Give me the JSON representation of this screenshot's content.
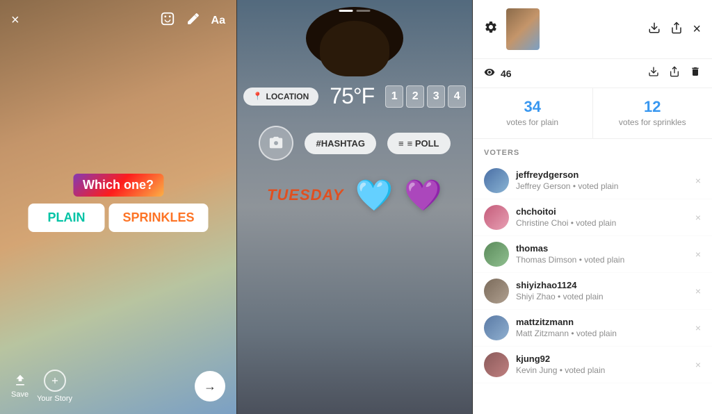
{
  "leftPanel": {
    "tools": {
      "close": "×",
      "sticker": "😊",
      "draw": "✏",
      "text": "Aa"
    },
    "poll": {
      "question": "Which one?",
      "option1": "PLAIN",
      "option2": "SPRINKLES"
    },
    "bottomBar": {
      "saveLabel": "Save",
      "storyLabel": "Your Story",
      "nextArrow": "→"
    }
  },
  "middlePanel": {
    "progressDots": [
      "active",
      "inactive"
    ],
    "stickers": {
      "location": "📍LOCATION",
      "temperature": "75°F",
      "counter": [
        "1",
        "2",
        "3",
        "4"
      ],
      "hashtag": "#HASHTAG",
      "poll": "≡ POLL",
      "day": "TUESDAY"
    }
  },
  "rightPanel": {
    "header": {
      "gearIcon": "⚙",
      "downloadIcon": "⬇",
      "shareIcon": "↑",
      "closeIcon": "×"
    },
    "views": {
      "icon": "👁",
      "count": "46",
      "downloadIcon": "⬇",
      "shareIcon": "↑",
      "deleteIcon": "🗑"
    },
    "votes": {
      "plain": {
        "count": "34",
        "label": "votes for plain"
      },
      "sprinkles": {
        "count": "12",
        "label": "votes for sprinkles"
      }
    },
    "votersTitle": "VOTERS",
    "voters": [
      {
        "username": "jeffreydgerson",
        "detail": "Jeffrey Gerson • voted plain",
        "avatarClass": "av1"
      },
      {
        "username": "chchoitoi",
        "detail": "Christine Choi • voted plain",
        "avatarClass": "av2"
      },
      {
        "username": "thomas",
        "detail": "Thomas Dimson • voted plain",
        "avatarClass": "av3"
      },
      {
        "username": "shiyizhao1124",
        "detail": "Shiyi Zhao • voted plain",
        "avatarClass": "av4"
      },
      {
        "username": "mattzitzmann",
        "detail": "Matt Zitzmann • voted plain",
        "avatarClass": "av5"
      },
      {
        "username": "kjung92",
        "detail": "Kevin Jung • voted plain",
        "avatarClass": "av6"
      }
    ]
  }
}
